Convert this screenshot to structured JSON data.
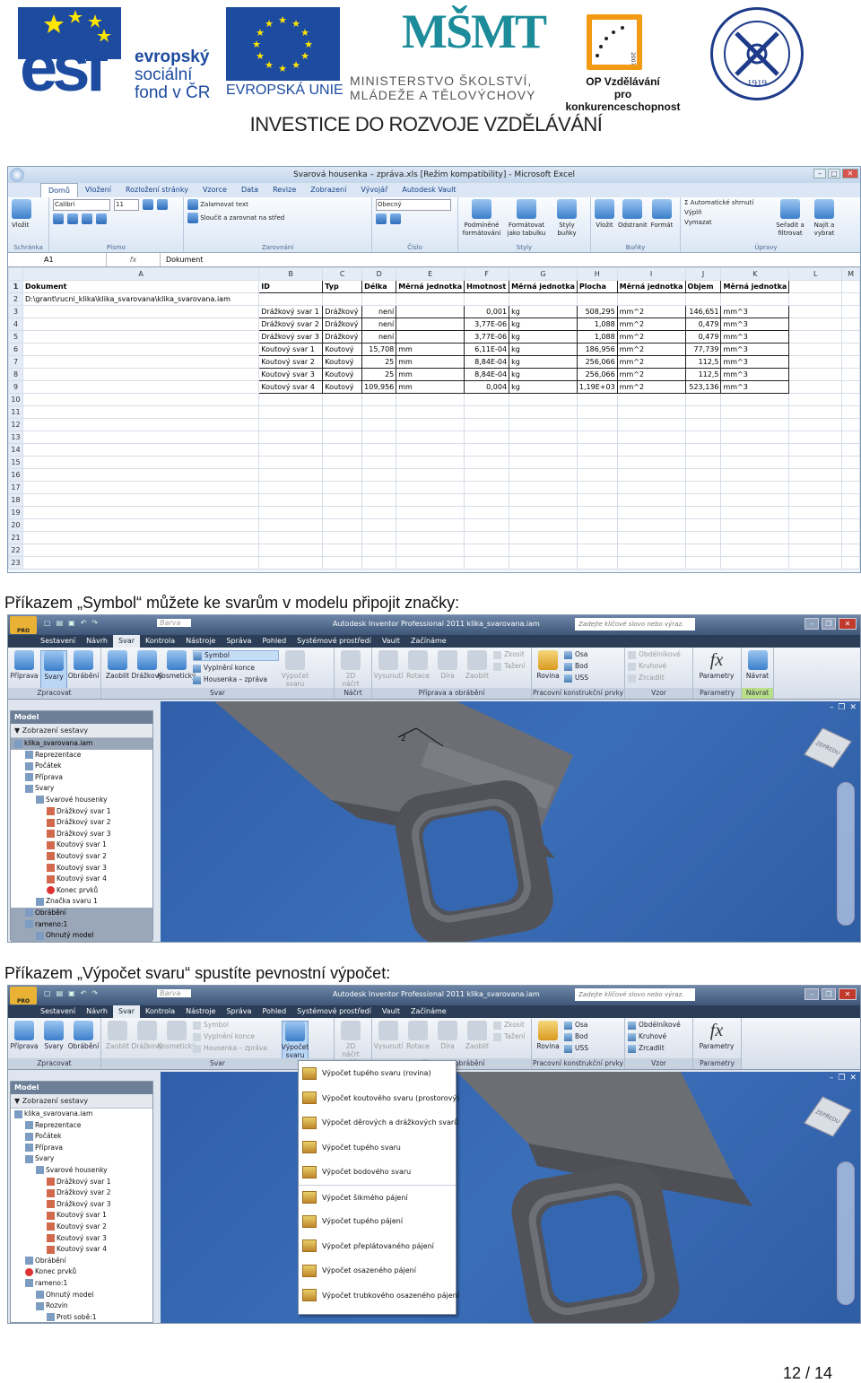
{
  "header": {
    "esf_big": "esf",
    "esf_lines": [
      "evropský",
      "sociální",
      "fond v ČR"
    ],
    "eu_label": "EVROPSKÁ UNIE",
    "msmt_logo": "MŠMT",
    "msmt_lines": [
      "MINISTERSTVO ŠKOLSTVÍ,",
      "MLÁDEŽE A TĚLOVÝCHOVY"
    ],
    "op_lines": [
      "OP Vzdělávání",
      "pro konkurenceschopnost"
    ],
    "op_years": "2007-13",
    "seal_year": "1919",
    "investice": "INVESTICE DO ROZVOJE VZDĚLÁVÁNÍ"
  },
  "excel": {
    "title": "Svarová housenka – zpráva.xls  [Režim kompatibility]  -  Microsoft Excel",
    "tabs": [
      "Domů",
      "Vložení",
      "Rozložení stránky",
      "Vzorce",
      "Data",
      "Revize",
      "Zobrazení",
      "Vývojář",
      "Autodesk Vault"
    ],
    "ribbon": {
      "clipboard": {
        "paste": "Vložit",
        "label": "Schránka"
      },
      "font": {
        "name": "Calibri",
        "size": "11",
        "label": "Písmo"
      },
      "align": {
        "wrap": "Zalamovat text",
        "merge": "Sloučit a zarovnat na střed",
        "label": "Zarovnání"
      },
      "number": {
        "format": "Obecný",
        "label": "Číslo"
      },
      "styles": {
        "cond": "Podmíněné formátování",
        "table": "Formátovat jako tabulku",
        "cell": "Styly buňky",
        "label": "Styly"
      },
      "cells": {
        "insert": "Vložit",
        "delete": "Odstranit",
        "format": "Formát",
        "label": "Buňky"
      },
      "edit": {
        "sum": "Automatické shrnutí",
        "fill": "Výplň",
        "clear": "Vymazat",
        "sort": "Seřadit a filtrovat",
        "find": "Najít a vybrat",
        "label": "Úpravy"
      }
    },
    "namebox": "A1",
    "fx": "fx",
    "formula": "Dokument",
    "columns": [
      "A",
      "B",
      "C",
      "D",
      "E",
      "F",
      "G",
      "H",
      "I",
      "J",
      "K",
      "L",
      "M"
    ],
    "rows": [
      [
        "Dokument",
        "ID",
        "Typ",
        "Délka",
        "Měrná jednotka",
        "Hmotnost",
        "Měrná jednotka",
        "Plocha",
        "Měrná jednotka",
        "Objem",
        "Měrná jednotka",
        "",
        ""
      ],
      [
        "D:\\grant\\rucni_klika\\klika_svarovana\\klika_svarovana.iam",
        "",
        "",
        "",
        "",
        "",
        "",
        "",
        "",
        "",
        "",
        "",
        ""
      ],
      [
        "",
        "Drážkový svar 1",
        "Drážkový",
        "není",
        "",
        "0,001",
        "kg",
        "508,295",
        "mm^2",
        "146,651",
        "mm^3",
        "",
        ""
      ],
      [
        "",
        "Drážkový svar 2",
        "Drážkový",
        "není",
        "",
        "3,77E-06",
        "kg",
        "1,088",
        "mm^2",
        "0,479",
        "mm^3",
        "",
        ""
      ],
      [
        "",
        "Drážkový svar 3",
        "Drážkový",
        "není",
        "",
        "3,77E-06",
        "kg",
        "1,088",
        "mm^2",
        "0,479",
        "mm^3",
        "",
        ""
      ],
      [
        "",
        "Koutový svar 1",
        "Koutový",
        "15,708",
        "mm",
        "6,11E-04",
        "kg",
        "186,956",
        "mm^2",
        "77,739",
        "mm^3",
        "",
        ""
      ],
      [
        "",
        "Koutový svar 2",
        "Koutový",
        "25",
        "mm",
        "8,84E-04",
        "kg",
        "256,066",
        "mm^2",
        "112,5",
        "mm^3",
        "",
        ""
      ],
      [
        "",
        "Koutový svar 3",
        "Koutový",
        "25",
        "mm",
        "8,84E-04",
        "kg",
        "256,066",
        "mm^2",
        "112,5",
        "mm^3",
        "",
        ""
      ],
      [
        "",
        "Koutový svar 4",
        "Koutový",
        "109,956",
        "mm",
        "0,004",
        "kg",
        "1,19E+03",
        "mm^2",
        "523,136",
        "mm^3",
        "",
        ""
      ]
    ],
    "row_count": 23
  },
  "caption1": "Příkazem „Symbol“ můžete ke svarům v modelu připojit značky:",
  "caption2": "Příkazem „Výpočet svaru“ spustíte pevnostní výpočet:",
  "inventor": {
    "title": "Autodesk Inventor Professional 2011   klika_svarovana.iam",
    "search": "Zadejte klíčové slovo nebo výraz.",
    "color": "Barva",
    "pro": "PRO",
    "tabs": [
      "Sestavení",
      "Návrh",
      "Svar",
      "Kontrola",
      "Nástroje",
      "Správa",
      "Pohled",
      "Systémové prostředí",
      "Vault",
      "Začínáme"
    ],
    "groups": {
      "zpracovat": {
        "label": "Zpracovat",
        "items": [
          "Příprava",
          "Svary",
          "Obrábění"
        ]
      },
      "svar": {
        "label": "Svar",
        "items": [
          "Zaoblit",
          "Drážkový",
          "Kosmetický"
        ],
        "col": [
          "Symbol",
          "Vyplnění konce",
          "Housenka – zpráva"
        ],
        "calc": "Výpočet svaru"
      },
      "nacrt": {
        "label": "Náčrt",
        "items": [
          "2D náčrt"
        ]
      },
      "priprava": {
        "label": "Příprava a obrábění",
        "items": [
          "Vysunutí",
          "Rotace",
          "Díra",
          "Zaoblit"
        ],
        "col": [
          "Zkosit",
          "Tažení"
        ]
      },
      "pracovni": {
        "label": "Pracovní konstrukční prvky",
        "items": [
          "Rovina"
        ],
        "col": [
          "Osa",
          "Bod",
          "USS"
        ]
      },
      "vzor": {
        "label": "Vzor",
        "col": [
          "Obdélníkové",
          "Kruhové",
          "Zrcadlit"
        ]
      },
      "parametry": {
        "label": "Parametry",
        "items": [
          "Parametry"
        ]
      },
      "navrat": {
        "label": "Návrat",
        "items": [
          "Návrat"
        ]
      }
    },
    "browser": {
      "title": "Model",
      "toolbar": "Zobrazení sestavy",
      "tree1": [
        "klika_svarovana.iam",
        "Reprezentace",
        "Počátek",
        "Příprava",
        "Svary",
        "Svarové housenky",
        "Drážkový svar 1",
        "Drážkový svar 2",
        "Drážkový svar 3",
        "Koutový svar 1",
        "Koutový svar 2",
        "Koutový svar 3",
        "Koutový svar 4",
        "Konec prvků",
        "Značka svaru 1",
        "Obrábění",
        "rameno:1",
        "Ohnutý model"
      ],
      "tree2": [
        "klika_svarovana.iam",
        "Reprezentace",
        "Počátek",
        "Příprava",
        "Svary",
        "Svarové housenky",
        "Drážkový svar 1",
        "Drážkový svar 2",
        "Drážkový svar 3",
        "Koutový svar 1",
        "Koutový svar 2",
        "Koutový svar 3",
        "Koutový svar 4",
        "Obrábění",
        "Konec prvků",
        "rameno:1",
        "Ohnutý model",
        "Rozvin",
        "Proti sobě:1"
      ]
    },
    "weld_symbol_label": "2",
    "viewcube": "ZEPŘEDU",
    "menu": [
      "Výpočet tupého svaru (rovina)",
      "Výpočet koutového svaru (prostorový)",
      "Výpočet děrových a drážkových svarů",
      "Výpočet tupého svaru",
      "Výpočet bodového svaru",
      "Výpočet šikmého pájení",
      "Výpočet tupého pájení",
      "Výpočet přeplátovaného pájení",
      "Výpočet osazeného pájení",
      "Výpočet trubkového osazeného pájení"
    ]
  },
  "page": "12 / 14",
  "colors": {
    "brand_blue": "#1d4ba0",
    "msmt_teal": "#1c8c9a",
    "op_orange": "#f39a14",
    "viewport_blue": "#3566b0"
  }
}
